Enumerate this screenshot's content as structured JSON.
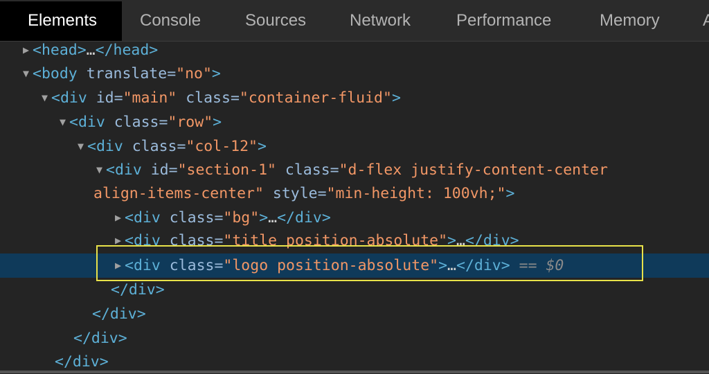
{
  "tabs": [
    "Elements",
    "Console",
    "Sources",
    "Network",
    "Performance",
    "Memory",
    "A"
  ],
  "tree": {
    "head": {
      "open": "<head>",
      "ellipsis": "…",
      "close": "</head>"
    },
    "body": {
      "open": "<body",
      "attr": "translate",
      "value": "\"no\"",
      "end": ">"
    },
    "main": {
      "open": "<div",
      "attr1": "id",
      "val1": "\"main\"",
      "attr2": "class",
      "val2": "\"container-fluid\"",
      "end": ">"
    },
    "row": {
      "open": "<div",
      "attr": "class",
      "val": "\"row\"",
      "end": ">"
    },
    "col": {
      "open": "<div",
      "attr": "class",
      "val": "\"col-12\"",
      "end": ">"
    },
    "section": {
      "open": "<div",
      "attr1": "id",
      "val1": "\"section-1\"",
      "attr2": "class",
      "val2a": "\"d-flex justify-content-center",
      "val2b": "align-items-center\"",
      "attr3": "style",
      "val3": "\"min-height: 100vh;\"",
      "end": ">"
    },
    "bg": {
      "open": "<div",
      "attr": "class",
      "val": "\"bg\"",
      "mid": ">",
      "ellipsis": "…",
      "close": "</div>"
    },
    "title": {
      "open": "<div",
      "attr": "class",
      "val": "\"title position-absolute\"",
      "mid": ">",
      "ellipsis": "…",
      "close": "</div>"
    },
    "logo": {
      "open": "<div",
      "attr": "class",
      "val": "\"logo position-absolute\"",
      "mid": ">",
      "ellipsis": "…",
      "close": "</div>",
      "eqeq": "==",
      "dollar": "$0"
    },
    "close_div": "</div>"
  }
}
